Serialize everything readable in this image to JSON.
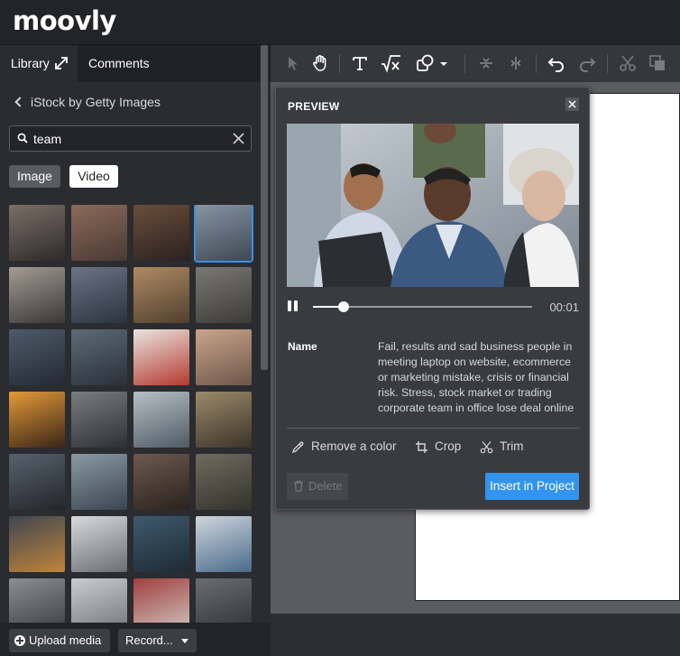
{
  "app": {
    "logo": "moovly"
  },
  "tabs": {
    "library": "Library",
    "comments": "Comments"
  },
  "library": {
    "breadcrumb": "iStock by Getty Images",
    "search": {
      "value": "team",
      "placeholder": ""
    },
    "filters": {
      "image": "Image",
      "video": "Video",
      "active": "Video"
    },
    "thumbnails": [
      {
        "c1": "#7a6f68",
        "c2": "#2f2a28"
      },
      {
        "c1": "#8b6a5a",
        "c2": "#4a3a33"
      },
      {
        "c1": "#6a4e3a",
        "c2": "#2a2120"
      },
      {
        "c1": "#8794a2",
        "c2": "#3d4854"
      },
      {
        "c1": "#a39b93",
        "c2": "#3c3836"
      },
      {
        "c1": "#6b7486",
        "c2": "#2c3340"
      },
      {
        "c1": "#b08a63",
        "c2": "#50402f"
      },
      {
        "c1": "#7a7873",
        "c2": "#3d3b38"
      },
      {
        "c1": "#4e5a6a",
        "c2": "#242a33"
      },
      {
        "c1": "#5c6b78",
        "c2": "#2a3038"
      },
      {
        "c1": "#e9e5e0",
        "c2": "#b33a30"
      },
      {
        "c1": "#caa58b",
        "c2": "#6d5649"
      },
      {
        "c1": "#e39a3a",
        "c2": "#3a2516"
      },
      {
        "c1": "#7a7d82",
        "c2": "#2e2f33"
      },
      {
        "c1": "#b8c0c6",
        "c2": "#4f5a63"
      },
      {
        "c1": "#9c8a6a",
        "c2": "#3b342a"
      },
      {
        "c1": "#58626c",
        "c2": "#22262b"
      },
      {
        "c1": "#8a9aa5",
        "c2": "#3a4550"
      },
      {
        "c1": "#6d5a4f",
        "c2": "#2a221e"
      },
      {
        "c1": "#6e6c5f",
        "c2": "#34332c"
      },
      {
        "c1": "#3f4650",
        "c2": "#c0843a"
      },
      {
        "c1": "#d8dadc",
        "c2": "#6a6e72"
      },
      {
        "c1": "#3e5a6e",
        "c2": "#1e2a33"
      },
      {
        "c1": "#cfd6dc",
        "c2": "#4a6a8a"
      },
      {
        "c1": "#8a8f93",
        "c2": "#3a3c3f"
      },
      {
        "c1": "#c9cdd0",
        "c2": "#6f7477"
      },
      {
        "c1": "#a04040",
        "c2": "#d0c8c0"
      },
      {
        "c1": "#6a6d70",
        "c2": "#2f3133"
      }
    ],
    "selected_index": 3,
    "upload_label": "Upload media",
    "record_label": "Record..."
  },
  "toolbar": {
    "icons": [
      "select-arrow-icon",
      "hand-icon",
      "text-icon",
      "formula-icon",
      "shapes-icon",
      "align-vertical-icon",
      "align-horizontal-icon",
      "undo-icon",
      "redo-icon",
      "cut-icon",
      "duplicate-icon"
    ]
  },
  "preview": {
    "title": "PREVIEW",
    "time": "00:01",
    "progress": 0.14,
    "name_label": "Name",
    "description": "Fail, results and sad business people in meeting laptop on website, ecommerce or marketing mistake, crisis or financial risk. Stress, stock market or trading corporate team in office lose deal online",
    "actions": {
      "remove_color": "Remove a color",
      "crop": "Crop",
      "trim": "Trim"
    },
    "delete_label": "Delete",
    "insert_label": "Insert in Project"
  },
  "colors": {
    "accent": "#3294ee",
    "selected_outline": "#3b8fe0",
    "background": "#2f3033"
  }
}
